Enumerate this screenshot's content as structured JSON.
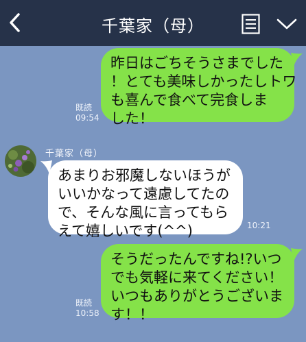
{
  "header": {
    "title": "千葉家（母）",
    "back_icon": "chevron-left-icon",
    "notes_icon": "notes-icon",
    "menu_icon": "chevron-down-icon"
  },
  "colors": {
    "background": "#7b96c1",
    "header": "#263249",
    "outgoing_bubble": "#85e249",
    "incoming_bubble": "#ffffff"
  },
  "messages": [
    {
      "direction": "outgoing",
      "text": "昨日はごちそうさまでした\n！とても美味しかったしトワ\nも喜んで食べて完食しま\nした！",
      "read_label": "既読",
      "time": "09:54"
    },
    {
      "direction": "incoming",
      "sender": "千葉家（母）",
      "text": "あまりお邪魔しないほうが\nいいかなって遠慮してたの\nで、そんな風に言ってもら\nえて嬉しいです(^^)",
      "time": "10:21"
    },
    {
      "direction": "outgoing",
      "text": "そうだったんですね!?いつ\nでも気軽に来てください！\nいつもありがとうございま\nす！！",
      "read_label": "既読",
      "time": "10:58"
    }
  ]
}
